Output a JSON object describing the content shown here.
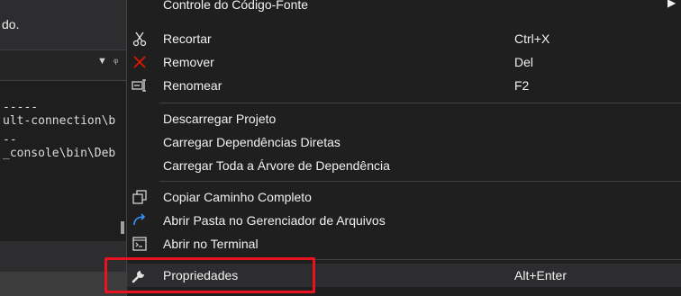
{
  "left_panel": {
    "top_text": "do.",
    "output_lines": [
      "-----",
      "ult-connection\\b",
      "--",
      "_console\\bin\\Deb"
    ]
  },
  "menu": {
    "items": [
      {
        "label": "Controle do Código-Fonte",
        "shortcut": "",
        "icon": "none",
        "submenu": true
      },
      {
        "label": "Recortar",
        "shortcut": "Ctrl+X",
        "icon": "scissors-icon"
      },
      {
        "label": "Remover",
        "shortcut": "Del",
        "icon": "close-icon"
      },
      {
        "label": "Renomear",
        "shortcut": "F2",
        "icon": "rename-icon"
      },
      {
        "label": "Descarregar Projeto",
        "shortcut": ""
      },
      {
        "label": "Carregar Dependências Diretas",
        "shortcut": ""
      },
      {
        "label": "Carregar Toda a Árvore de Dependência",
        "shortcut": ""
      },
      {
        "label": "Copiar Caminho Completo",
        "shortcut": "",
        "icon": "copy-icon"
      },
      {
        "label": "Abrir Pasta no Gerenciador de Arquivos",
        "shortcut": "",
        "icon": "open-folder-arrow-icon"
      },
      {
        "label": "Abrir no Terminal",
        "shortcut": "",
        "icon": "terminal-icon"
      },
      {
        "label": "Propriedades",
        "shortcut": "Alt+Enter",
        "icon": "wrench-icon"
      }
    ]
  },
  "colors": {
    "accent_blue": "#3794ff",
    "remove_red": "#e51400",
    "annotation_red": "#e8131e"
  }
}
